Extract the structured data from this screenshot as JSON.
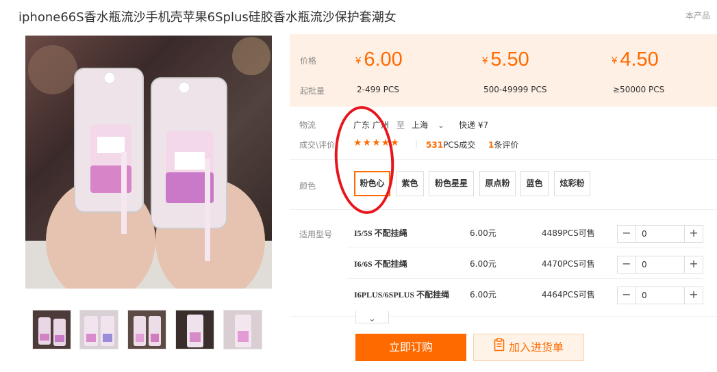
{
  "header": {
    "title": "iphone66S香水瓶流沙手机壳苹果6Splus硅胶香水瓶流沙保护套潮女",
    "tag": "本产品"
  },
  "gallery": {
    "main_alt": "pink perfume-bottle glitter phone cases",
    "thumb_count": 5
  },
  "pricing": {
    "price_label": "价格",
    "moq_label": "起批量",
    "currency": "¥",
    "tiers": [
      {
        "price": "6.00",
        "qty": "2-499 PCS"
      },
      {
        "price": "5.50",
        "qty": "500-49999 PCS"
      },
      {
        "price": "4.50",
        "qty": "≥50000 PCS"
      }
    ]
  },
  "logistics": {
    "label": "物流",
    "from": "广东 广州",
    "to_word": "至",
    "to": "上海",
    "express": "快递 ¥7"
  },
  "deals": {
    "label": "成交\\评价",
    "stars": "★★★★★",
    "sold_count": "531",
    "sold_suffix": "PCS成交",
    "review_count": "1",
    "review_suffix": "条评价"
  },
  "colors": {
    "label": "颜色",
    "options": [
      "粉色心",
      "紫色",
      "粉色星星",
      "原点粉",
      "蓝色",
      "炫彩粉"
    ],
    "selected": "粉色心"
  },
  "models": {
    "label": "适用型号",
    "rows": [
      {
        "name": "I5/5S 不配挂绳",
        "price": "6.00元",
        "stock": "4489",
        "stock_suffix": "PCS可售",
        "qty": "0"
      },
      {
        "name": "I6/6S 不配挂绳",
        "price": "6.00元",
        "stock": "4470",
        "stock_suffix": "PCS可售",
        "qty": "0"
      },
      {
        "name": "I6PLUS/6SPLUS 不配挂绳",
        "price": "6.00元",
        "stock": "4464",
        "stock_suffix": "PCS可售",
        "qty": "0"
      }
    ],
    "minus": "−",
    "plus": "+"
  },
  "actions": {
    "buy": "立即订购",
    "cart": "加入进货单"
  },
  "theme": {
    "accent": "#ff6a00",
    "annotation": "#e8141b",
    "price_bg": "#fff0e5"
  }
}
